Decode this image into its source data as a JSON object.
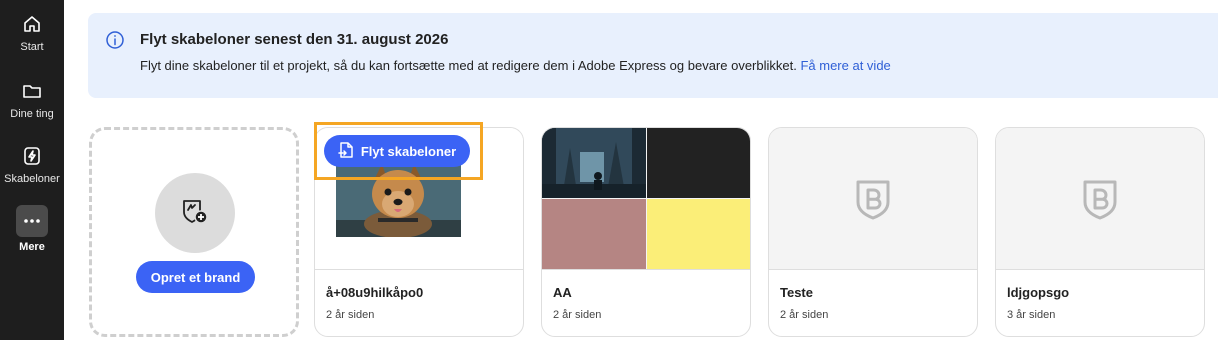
{
  "sidebar": {
    "items": [
      {
        "label": "Start",
        "icon": "home-icon"
      },
      {
        "label": "Dine ting",
        "icon": "folder-icon"
      },
      {
        "label": "Skabeloner",
        "icon": "templates-icon"
      },
      {
        "label": "Mere",
        "icon": "more-icon"
      }
    ]
  },
  "banner": {
    "title": "Flyt skabeloner senest den 31. august 2026",
    "body": "Flyt dine skabeloner til et projekt, så du kan fortsætte med at redigere dem i Adobe Express og bevare overblikket.",
    "link": "Få mere at vide"
  },
  "create_card": {
    "button_label": "Opret et brand"
  },
  "move_button": {
    "label": "Flyt skabeloner"
  },
  "brands": [
    {
      "name": "å+08u9hilkåpo0",
      "date": "2 år siden"
    },
    {
      "name": "AA",
      "date": "2 år siden"
    },
    {
      "name": "Teste",
      "date": "2 år siden"
    },
    {
      "name": "ldjgopsgo",
      "date": "3 år siden"
    }
  ],
  "colors": {
    "accent": "#3b63f5",
    "highlight": "#f5a623",
    "banner_bg": "#e8f0fd",
    "sidebar_bg": "#1e1e1e",
    "link": "#2f5fd6"
  }
}
